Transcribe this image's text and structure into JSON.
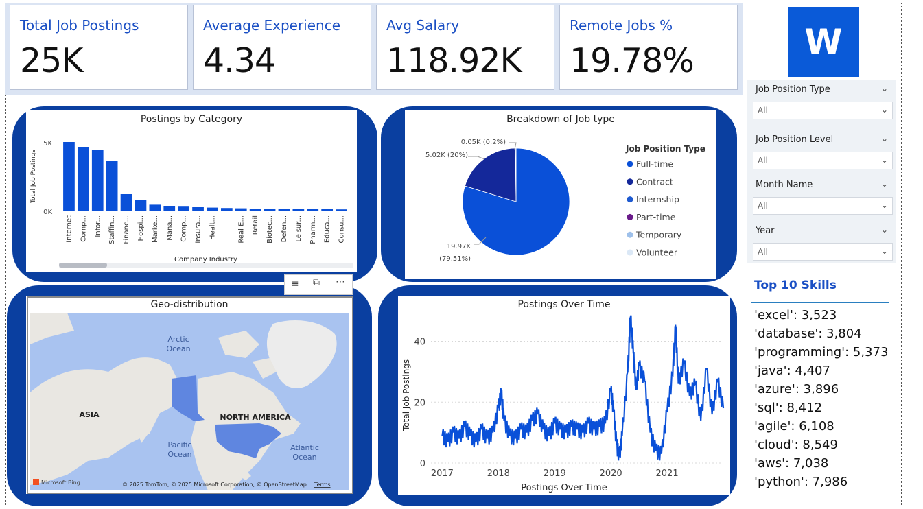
{
  "kpis": [
    {
      "title": "Total Job Postings",
      "value": "25K"
    },
    {
      "title": "Average Experience",
      "value": "4.34"
    },
    {
      "title": "Avg Salary",
      "value": "118.92K"
    },
    {
      "title": "Remote Jobs %",
      "value": "19.78%"
    }
  ],
  "logo": {
    "letter": "W"
  },
  "slicers": [
    {
      "label": "Job Position Type",
      "value": "All"
    },
    {
      "label": "Job Position Level",
      "value": "All"
    },
    {
      "label": "Month Name",
      "value": "All"
    },
    {
      "label": "Year",
      "value": "All"
    }
  ],
  "skills": {
    "title": "Top 10 Skills",
    "items": [
      "'excel': 3,523",
      "'database': 3,804",
      "'programming': 5,373",
      "'java': 4,407",
      "'azure': 3,896",
      "'sql': 8,412",
      "'agile': 6,108",
      "'cloud': 8,549",
      "'aws': 7,038",
      "'python': 7,986"
    ]
  },
  "map": {
    "title": "Geo-distribution",
    "labels": {
      "arctic": [
        "Arctic",
        "Ocean"
      ],
      "asia": "ASIA",
      "north_america": "NORTH AMERICA",
      "pacific": [
        "Pacific",
        "Ocean"
      ],
      "atlantic": [
        "Atlantic",
        "Ocean"
      ]
    },
    "attribution": "© 2025 TomTom, © 2025 Microsoft Corporation, © OpenStreetMap",
    "terms": "Terms",
    "provider": "Microsoft Bing"
  },
  "colors": {
    "primary": "#0a50d8",
    "panel": "#0a3fa0",
    "contract": "#14289a",
    "kpi_title": "#1a4fc4"
  },
  "chart_data": [
    {
      "type": "bar",
      "title": "Postings by Category",
      "xlabel": "Company Industry",
      "ylabel": "Total Job Postings",
      "yticks": [
        "0K",
        "5K"
      ],
      "ylim": [
        0,
        5500
      ],
      "categories": [
        "Internet",
        "Comp...",
        "Infor...",
        "Staffin...",
        "Financ...",
        "Hospi...",
        "Marke...",
        "Mana...",
        "Comp...",
        "Insura...",
        "Healt...",
        "",
        "Real E...",
        "Retail",
        "Biotec...",
        "Defen...",
        "Leisur...",
        "Pharm...",
        "Educa...",
        "Consu..."
      ],
      "values": [
        5050,
        4700,
        4450,
        3700,
        1250,
        850,
        480,
        400,
        340,
        300,
        270,
        240,
        220,
        200,
        190,
        180,
        170,
        160,
        150,
        140
      ]
    },
    {
      "type": "pie",
      "title": "Breakdown of Job type",
      "legend_title": "Job Position Type",
      "legend_position": "right",
      "slices": [
        {
          "name": "Full-time",
          "value": 19.97,
          "label": "19.97K",
          "pct_label": "(79.51%)",
          "color": "#0a50d8"
        },
        {
          "name": "Contract",
          "value": 5.02,
          "label": "5.02K (20%)",
          "color": "#14289a"
        },
        {
          "name": "Internship",
          "value": 0.05,
          "label": "0.05K (0.2%)",
          "color": "#1e5ad0"
        },
        {
          "name": "Part-time",
          "value": 0.0,
          "color": "#6a1b8a"
        },
        {
          "name": "Temporary",
          "value": 0.0,
          "color": "#9ec0ea"
        },
        {
          "name": "Volunteer",
          "value": 0.0,
          "color": "#dbe8f6"
        }
      ]
    },
    {
      "type": "line",
      "title": "Postings Over Time",
      "xlabel": "Postings Over Time",
      "ylabel": "Total Job Postings",
      "xticks": [
        "2017",
        "2018",
        "2019",
        "2020",
        "2021"
      ],
      "yticks": [
        0,
        20,
        40
      ],
      "ylim": [
        0,
        48
      ],
      "xlim": [
        2016.8,
        2022.0
      ],
      "series": [
        {
          "x": [
            2017.0,
            2017.1,
            2017.2,
            2017.3,
            2017.4,
            2017.5,
            2017.6,
            2017.7,
            2017.8,
            2017.9,
            2018.0,
            2018.05,
            2018.1,
            2018.2,
            2018.3,
            2018.4,
            2018.5,
            2018.6,
            2018.7,
            2018.8,
            2018.9,
            2019.0,
            2019.1,
            2019.2,
            2019.3,
            2019.4,
            2019.5,
            2019.6,
            2019.7,
            2019.8,
            2019.9,
            2020.0,
            2020.05,
            2020.1,
            2020.15,
            2020.2,
            2020.3,
            2020.35,
            2020.4,
            2020.45,
            2020.5,
            2020.6,
            2020.7,
            2020.8,
            2020.9,
            2021.0,
            2021.1,
            2021.15,
            2021.2,
            2021.3,
            2021.4,
            2021.5,
            2021.6,
            2021.7,
            2021.8,
            2021.9,
            2022.0
          ],
          "y": [
            9,
            7,
            10,
            8,
            12,
            9,
            7,
            11,
            8,
            10,
            18,
            23,
            14,
            9,
            8,
            11,
            10,
            14,
            16,
            11,
            9,
            13,
            11,
            10,
            12,
            11,
            10,
            13,
            11,
            12,
            13,
            24,
            17,
            6,
            2,
            9,
            30,
            48,
            36,
            24,
            32,
            27,
            10,
            4,
            3,
            17,
            29,
            45,
            26,
            33,
            22,
            26,
            14,
            31,
            16,
            27,
            18
          ]
        }
      ]
    }
  ]
}
